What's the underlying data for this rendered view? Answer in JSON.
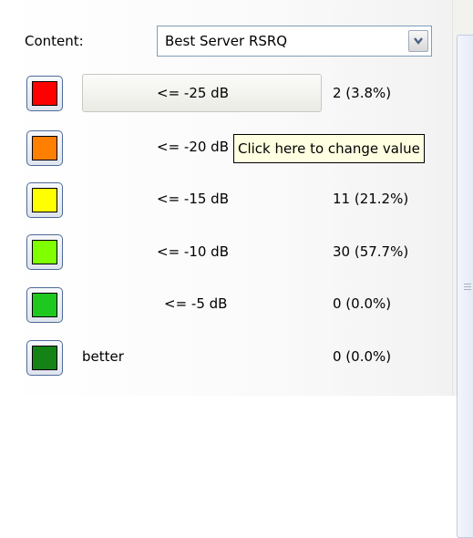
{
  "colors": {
    "accent_border": "#7f9db9",
    "tooltip_background": "#ffffe1"
  },
  "content_selector": {
    "label": "Content:",
    "selected_value": "Best Server RSRQ",
    "arrow_icon": "chevron-down-icon"
  },
  "legend_rows": [
    {
      "color": "#ff0000",
      "threshold": "<= -25 dB",
      "count": "2 (3.8%)"
    },
    {
      "color": "#ff8000",
      "threshold": "<= -20 dB",
      "count": ""
    },
    {
      "color": "#ffff00",
      "threshold": "<= -15 dB",
      "count": "11 (21.2%)"
    },
    {
      "color": "#80ff00",
      "threshold": "<= -10 dB",
      "count": "30 (57.7%)"
    },
    {
      "color": "#1ec81e",
      "threshold": "<= -5 dB",
      "count": "0 (0.0%)"
    },
    {
      "color": "#148214",
      "threshold": "better",
      "count": "0 (0.0%)"
    }
  ],
  "tooltip": {
    "text": "Click here to change value"
  }
}
